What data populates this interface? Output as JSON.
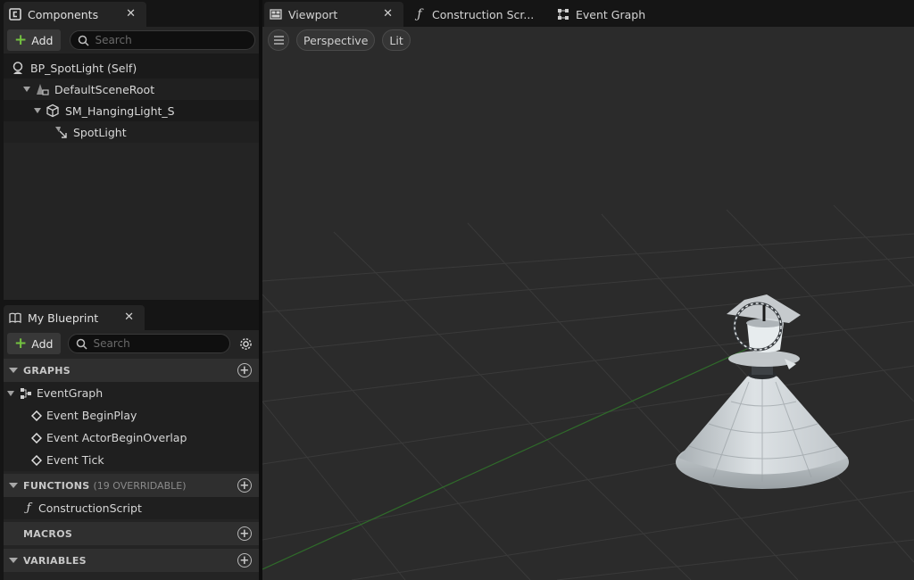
{
  "components_panel": {
    "tab_label": "Components",
    "add_label": "Add",
    "search_placeholder": "Search",
    "tree": [
      {
        "label": "BP_SpotLight (Self)"
      },
      {
        "label": "DefaultSceneRoot"
      },
      {
        "label": "SM_HangingLight_S"
      },
      {
        "label": "SpotLight"
      }
    ]
  },
  "my_blueprint_panel": {
    "tab_label": "My Blueprint",
    "add_label": "Add",
    "search_placeholder": "Search",
    "sections": {
      "graphs": {
        "label": "GRAPHS"
      },
      "functions": {
        "label": "FUNCTIONS",
        "sub": "(19 OVERRIDABLE)"
      },
      "macros": {
        "label": "MACROS"
      },
      "variables": {
        "label": "VARIABLES"
      }
    },
    "event_graph": "EventGraph",
    "events": [
      "Event BeginPlay",
      "Event ActorBeginOverlap",
      "Event Tick"
    ],
    "functions": [
      "ConstructionScript"
    ]
  },
  "document_tabs": [
    {
      "label": "Viewport"
    },
    {
      "label": "Construction Scr..."
    },
    {
      "label": "Event Graph"
    }
  ],
  "viewport": {
    "view_mode": "Perspective",
    "lighting_mode": "Lit"
  },
  "colors": {
    "accent_green": "#73c240",
    "panel_bg": "#242424",
    "viewport_bg": "#2b2b2b"
  }
}
